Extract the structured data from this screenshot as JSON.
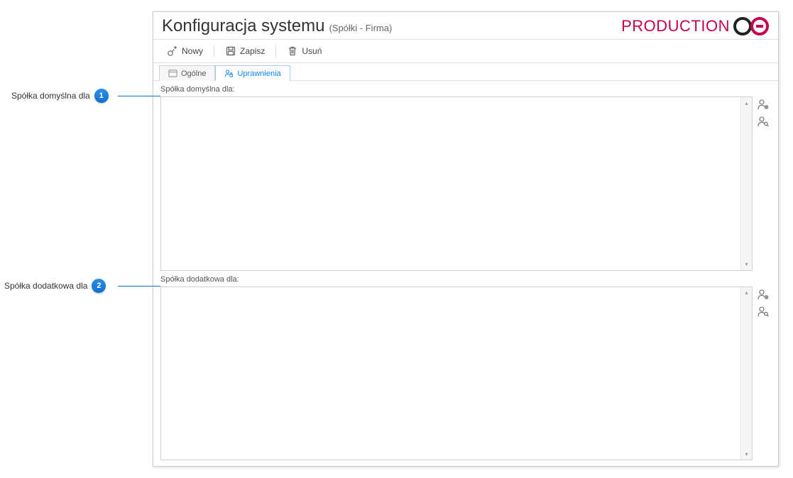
{
  "annotations": {
    "item1": {
      "label": "Spółka domyślna dla",
      "badge": "1"
    },
    "item2": {
      "label": "Spółka dodatkowa dla",
      "badge": "2"
    }
  },
  "header": {
    "title": "Konfiguracja systemu",
    "subtitle": "(Spółki - Firma)",
    "brand": "PRODUCTION"
  },
  "toolbar": {
    "new_label": "Nowy",
    "save_label": "Zapisz",
    "delete_label": "Usuń"
  },
  "tabs": {
    "general": "Ogólne",
    "permissions": "Uprawnienia"
  },
  "sections": {
    "default_company_label": "Spółka domyślna dla:",
    "additional_company_label": "Spółka dodatkowa dla:"
  }
}
